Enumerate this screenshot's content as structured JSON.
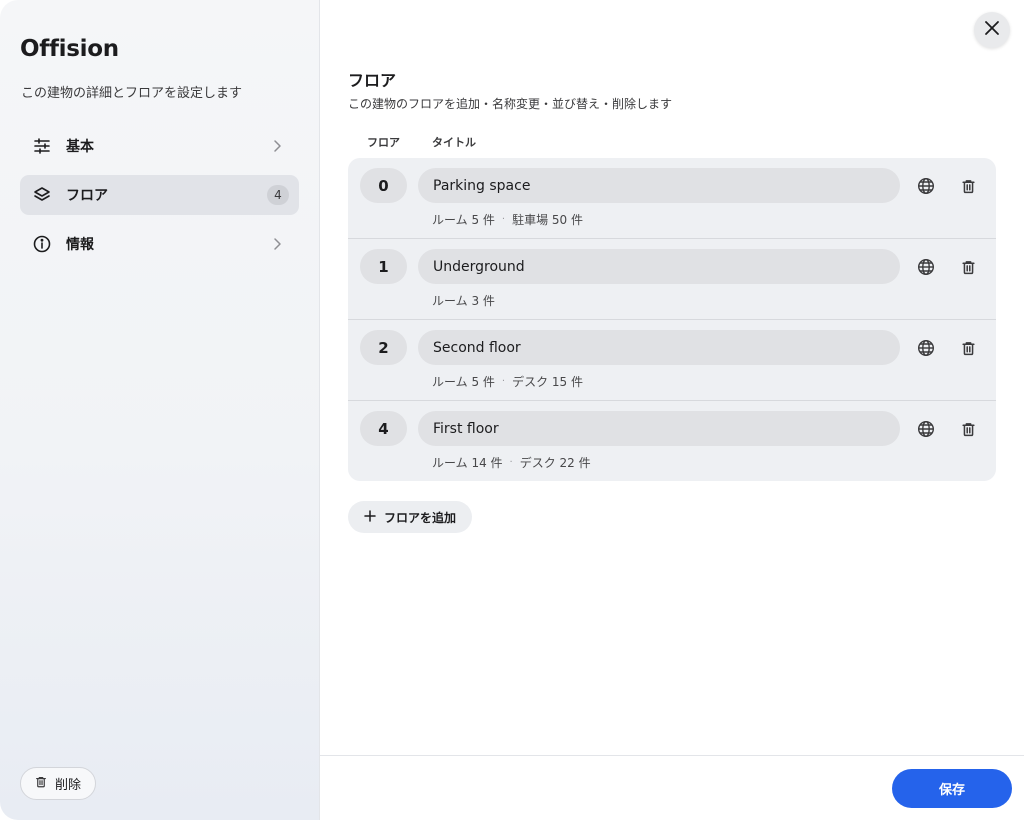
{
  "sidebar": {
    "title": "Offision",
    "subtitle": "この建物の詳細とフロアを設定します",
    "items": [
      {
        "label": "基本",
        "icon": "sliders-icon"
      },
      {
        "label": "フロア",
        "icon": "layers-icon",
        "badge": "4",
        "active": true
      },
      {
        "label": "情報",
        "icon": "info-icon"
      }
    ],
    "delete_label": "削除"
  },
  "main": {
    "section_title": "フロア",
    "section_desc": "この建物のフロアを追加・名称変更・並び替え・削除します",
    "col_floor": "フロア",
    "col_title": "タイトル",
    "floors": [
      {
        "number": "0",
        "title": "Parking space",
        "meta": [
          "ルーム 5 件",
          "駐車場 50 件"
        ]
      },
      {
        "number": "1",
        "title": "Underground",
        "meta": [
          "ルーム 3 件"
        ]
      },
      {
        "number": "2",
        "title": "Second floor",
        "meta": [
          "ルーム 5 件",
          "デスク 15 件"
        ]
      },
      {
        "number": "4",
        "title": "First floor",
        "meta": [
          "ルーム 14 件",
          "デスク 22 件"
        ]
      }
    ],
    "meta_separator": "·",
    "add_floor_label": "フロアを追加",
    "save_label": "保存"
  },
  "colors": {
    "accent": "#2563eb",
    "sidebar_bg": "#f3f4f7",
    "row_bg": "#eef0f3"
  }
}
